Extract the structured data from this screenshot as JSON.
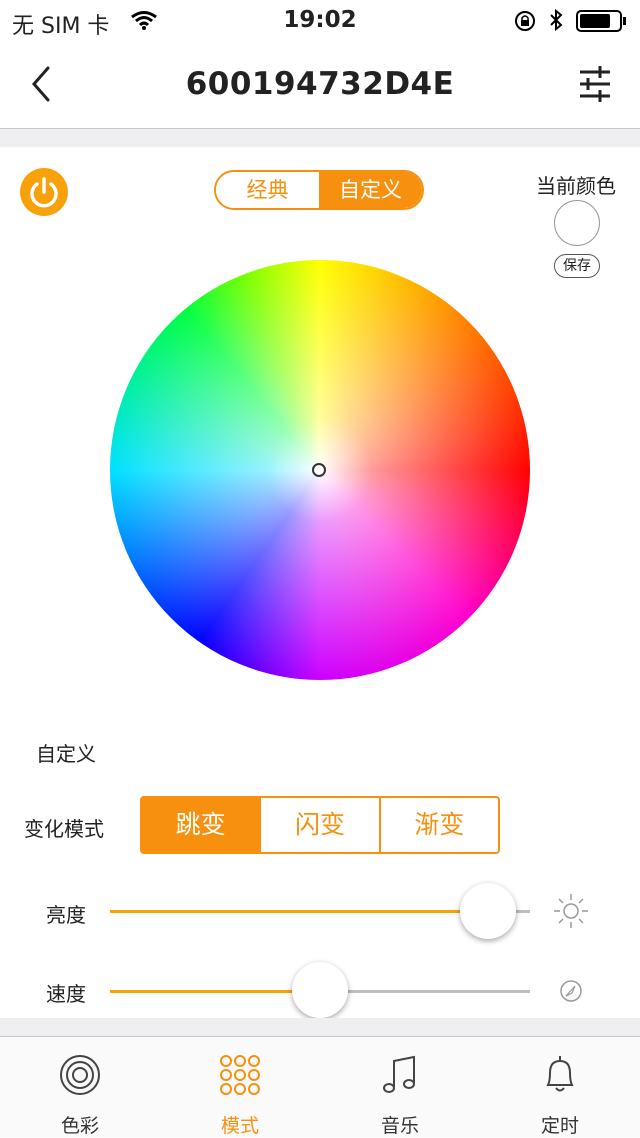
{
  "status_bar": {
    "carrier": "无 SIM 卡",
    "time": "19:02"
  },
  "nav": {
    "title": "600194732D4E"
  },
  "color_mode_tabs": [
    "经典",
    "自定义"
  ],
  "current_color": {
    "label": "当前颜色",
    "save_label": "保存",
    "value": "#ffffff"
  },
  "custom_label": "自定义",
  "change_mode": {
    "label": "变化模式",
    "options": [
      "跳变",
      "闪变",
      "渐变"
    ],
    "selected": "跳变"
  },
  "brightness": {
    "label": "亮度",
    "value_fraction": 0.9
  },
  "speed": {
    "label": "速度",
    "value_fraction": 0.5
  },
  "tabbar": {
    "items": [
      {
        "label": "色彩",
        "icon": "color-rings-icon"
      },
      {
        "label": "模式",
        "icon": "dots-grid-icon"
      },
      {
        "label": "音乐",
        "icon": "music-note-icon"
      },
      {
        "label": "定时",
        "icon": "bell-icon"
      }
    ],
    "active": "模式"
  },
  "colors": {
    "accent": "#f7900f",
    "power": "#f7a20b"
  }
}
